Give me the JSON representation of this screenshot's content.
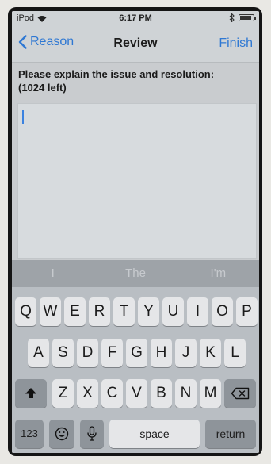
{
  "statusbar": {
    "carrier": "iPod",
    "time": "6:17 PM"
  },
  "nav": {
    "back_label": "Reason",
    "title": "Review",
    "finish_label": "Finish"
  },
  "form": {
    "prompt_line1": "Please explain the issue and resolution:",
    "prompt_line2": "(1024 left)",
    "text_value": ""
  },
  "keyboard": {
    "predictions": [
      "I",
      "The",
      "I'm"
    ],
    "row1": [
      "Q",
      "W",
      "E",
      "R",
      "T",
      "Y",
      "U",
      "I",
      "O",
      "P"
    ],
    "row2": [
      "A",
      "S",
      "D",
      "F",
      "G",
      "H",
      "J",
      "K",
      "L"
    ],
    "row3": [
      "Z",
      "X",
      "C",
      "V",
      "B",
      "N",
      "M"
    ],
    "numbers_label": "123",
    "space_label": "space",
    "return_label": "return"
  },
  "colors": {
    "accent": "#2f78d3",
    "caret": "#3b82e0"
  }
}
